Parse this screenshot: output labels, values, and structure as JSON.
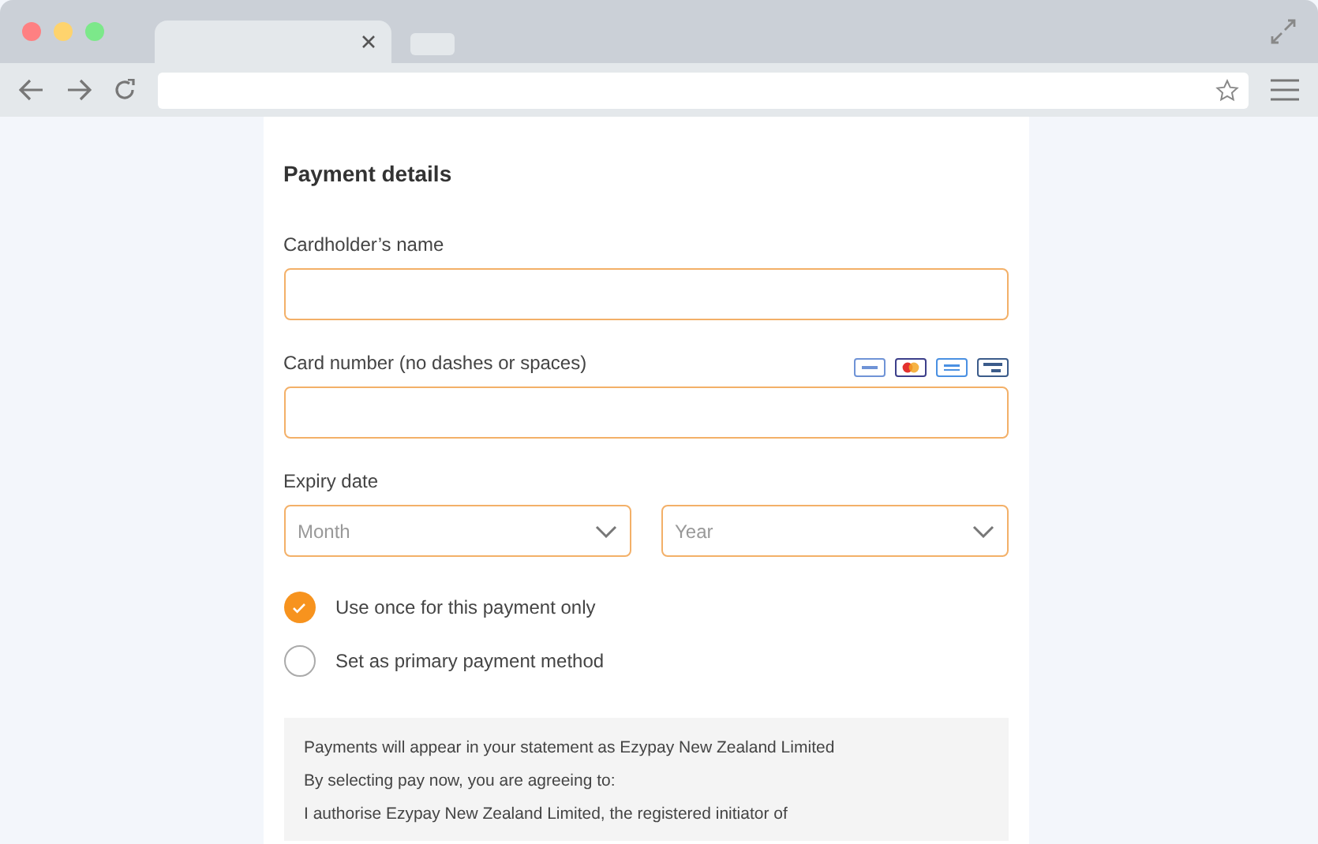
{
  "form": {
    "title": "Payment details",
    "fields": [
      {
        "label": "Cardholder’s name",
        "cards": false
      },
      {
        "label": "Card number (no dashes or spaces)",
        "cards": true
      }
    ],
    "expiry": {
      "label": "Expiry date",
      "selects": [
        {
          "placeholder": "Month"
        },
        {
          "placeholder": "Year"
        }
      ]
    },
    "options": [
      {
        "label": "Use once for this payment only",
        "selected": true
      },
      {
        "label": "Set as primary payment method",
        "selected": false
      }
    ],
    "notice": [
      "Payments will appear in your statement as Ezypay New Zealand Limited",
      "By selecting pay now, you are agreeing to:",
      "I authorise Ezypay New Zealand Limited, the registered initiator of"
    ]
  }
}
